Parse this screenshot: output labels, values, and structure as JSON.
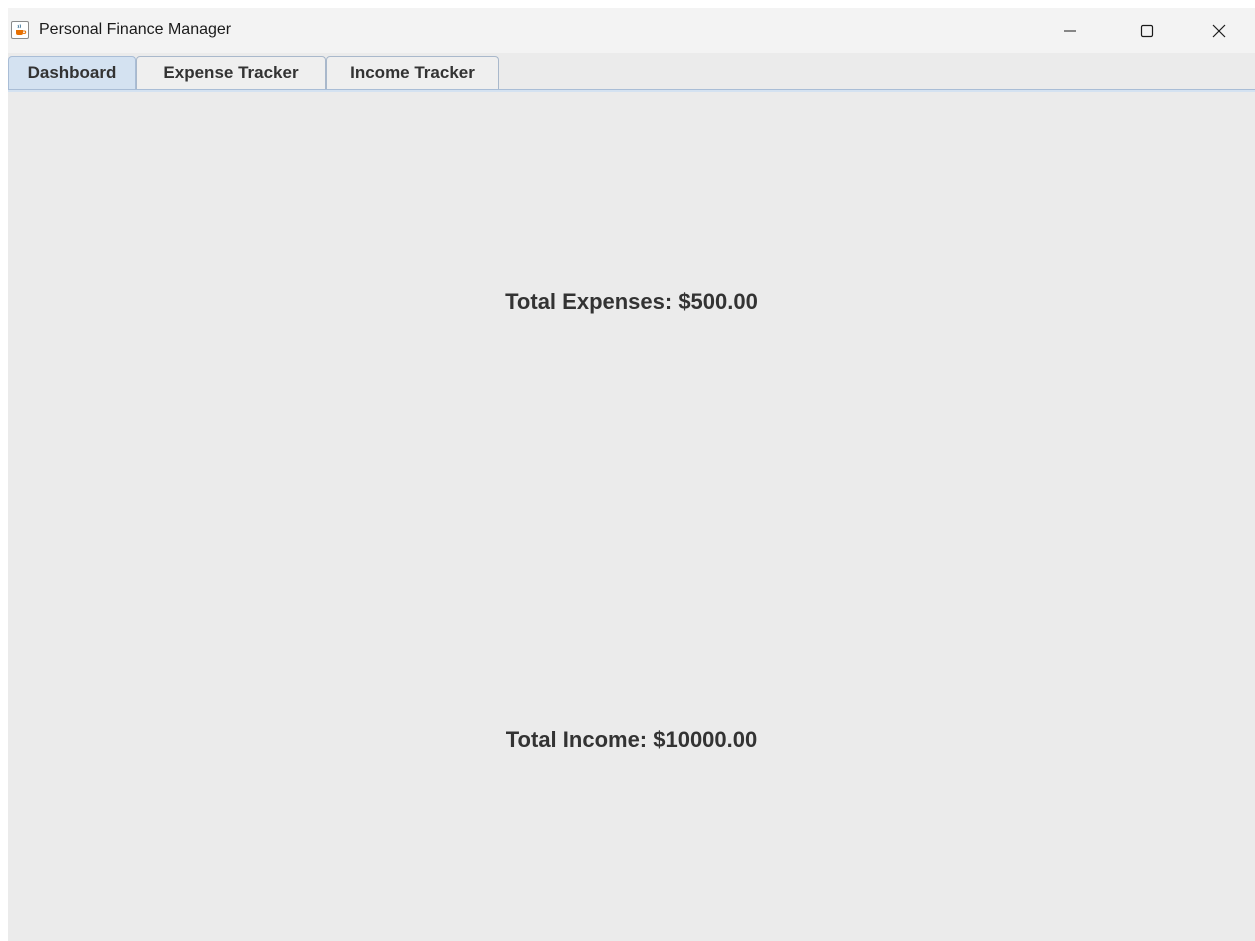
{
  "window": {
    "title": "Personal Finance Manager",
    "app_icon": "java-cup-icon",
    "controls": [
      "minimize-icon",
      "maximize-icon",
      "close-icon"
    ]
  },
  "tabs": [
    {
      "label": "Dashboard",
      "selected": true
    },
    {
      "label": "Expense Tracker",
      "selected": false
    },
    {
      "label": "Income Tracker",
      "selected": false
    }
  ],
  "dashboard": {
    "total_expenses": "Total Expenses: $500.00",
    "total_income": "Total Income: $10000.00"
  },
  "colors": {
    "window_background": "#ebebeb",
    "selected_tab": "#d4e2f1",
    "text": "#333333"
  }
}
